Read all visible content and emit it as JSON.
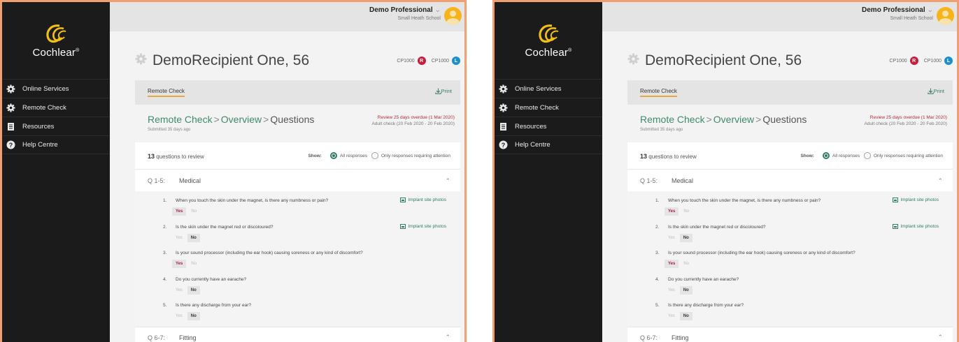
{
  "brand": {
    "name": "Cochlear",
    "mark": "®",
    "accent": "#e5a83a",
    "green": "#2f7f5f",
    "red": "#b02a3a",
    "blue": "#1a8fc9"
  },
  "nav": {
    "items": [
      {
        "label": "Online Services",
        "icon": "gear-icon"
      },
      {
        "label": "Remote Check",
        "icon": "gear-icon"
      },
      {
        "label": "Resources",
        "icon": "document-icon"
      },
      {
        "label": "Help Centre",
        "icon": "help-icon"
      }
    ]
  },
  "user": {
    "name": "Demo Professional",
    "school": "Small Heath School"
  },
  "patient": {
    "name": "DemoRecipient One, 56"
  },
  "processors": [
    {
      "label": "CP1000",
      "side": "R",
      "color": "#c81e3e"
    },
    {
      "label": "CP1000",
      "side": "L",
      "color": "#1a8fc9"
    }
  ],
  "tab": {
    "label": "Remote Check",
    "print": "Print"
  },
  "breadcrumb": {
    "item1": "Remote Check",
    "item2": "Overview",
    "current": "Questions",
    "sep": ">"
  },
  "submitted": "Submitted 35 days ago",
  "review": {
    "overdue": "Review 25 days overdue (1 Mar 2020)",
    "adult": "Adult check (20 Feb 2020 - 20 Feb 2020)"
  },
  "summary": {
    "count": "13",
    "text": " questions to review"
  },
  "filter": {
    "label": "Show:",
    "all": "All responses",
    "attention": "Only responses requiring attention"
  },
  "sections": [
    {
      "code": "Q 1-5:",
      "title": "Medical"
    },
    {
      "code": "Q 6-7:",
      "title": "Fitting"
    }
  ],
  "questions": [
    {
      "num": "1.",
      "text": "When you touch the skin under the magnet, is there any numbness or pain?",
      "answer": "Yes",
      "photos": "Implant site photos"
    },
    {
      "num": "2.",
      "text": "Is the skin under the magnet red or discoloured?",
      "answer": "No",
      "photos": "Implant site photos"
    },
    {
      "num": "3.",
      "text": "Is your sound processor (including the ear hook) causing soreness or any kind of discomfort?",
      "answer": "Yes",
      "photos": ""
    },
    {
      "num": "4.",
      "text": "Do you currently have an earache?",
      "answer": "No",
      "photos": ""
    },
    {
      "num": "5.",
      "text": "Is there any discharge from your ear?",
      "answer": "No",
      "photos": ""
    }
  ],
  "answers": {
    "yes": "Yes",
    "no": "No"
  }
}
